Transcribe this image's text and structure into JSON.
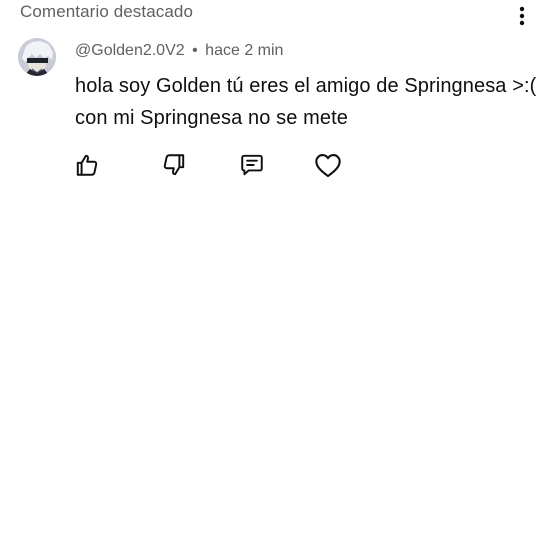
{
  "header": {
    "title": "Comentario destacado",
    "more_icon": "more-vertical-icon"
  },
  "comment": {
    "author": "@Golden2.0V2",
    "separator": "•",
    "time": "hace 2 min",
    "text": "hola soy Golden tú eres el amigo de Springnesa >:( con mi Springnesa no se mete",
    "avatar_icon": "avatar-image"
  },
  "actions": {
    "like_icon": "thumbs-up-icon",
    "dislike_icon": "thumbs-down-icon",
    "reply_icon": "comment-reply-icon",
    "heart_icon": "heart-icon"
  },
  "colors": {
    "text_primary": "#0f0f0f",
    "text_secondary": "#606060",
    "background": "#ffffff"
  }
}
